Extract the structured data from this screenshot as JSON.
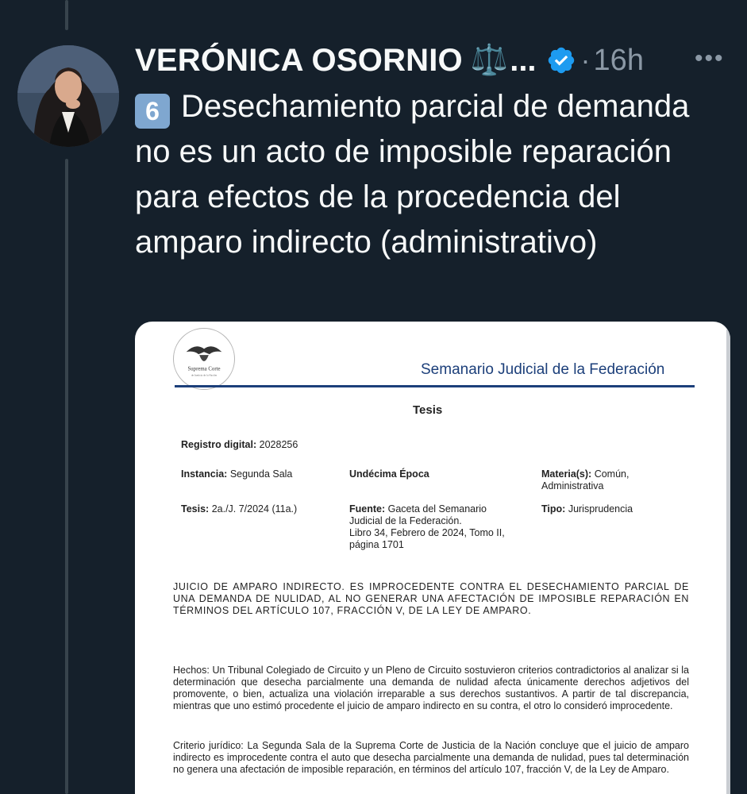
{
  "author": {
    "name": "VERÓNICA OSORNIO",
    "badge_emoji": "⚖️",
    "truncation": "...",
    "verified": true,
    "separator": "·",
    "time": "16h"
  },
  "more_label": "•••",
  "tweet": {
    "keycap": "6",
    "text": "Desechamiento parcial de demanda no es un acto de imposible reparación para efectos de la procedencia del amparo indirecto (administrativo)"
  },
  "document": {
    "logo_text": "Suprema Corte",
    "logo_subtext": "de Justicia de la Nación",
    "header_title": "Semanario Judicial de la Federación",
    "title": "Tesis",
    "registro_label": "Registro digital:",
    "registro_value": "2028256",
    "instancia_label": "Instancia:",
    "instancia_value": "Segunda Sala",
    "epoca": "Undécima Época",
    "materia_label": "Materia(s):",
    "materia_value_1": "Común,",
    "materia_value_2": "Administrativa",
    "tesis_label": "Tesis:",
    "tesis_value": "2a./J. 7/2024 (11a.)",
    "fuente_label": "Fuente:",
    "fuente_line_1": "Gaceta del Semanario",
    "fuente_line_2": "Judicial de la Federación.",
    "fuente_line_3": "Libro 34, Febrero de 2024, Tomo II,",
    "fuente_line_4": "página 1701",
    "tipo_label": "Tipo:",
    "tipo_value": "Jurisprudencia",
    "rubro": "JUICIO DE AMPARO INDIRECTO. ES IMPROCEDENTE CONTRA EL DESECHAMIENTO PARCIAL DE UNA DEMANDA DE NULIDAD, AL NO GENERAR UNA AFECTACIÓN DE IMPOSIBLE REPARACIÓN EN TÉRMINOS DEL ARTÍCULO 107, FRACCIÓN V, DE LA LEY DE AMPARO.",
    "hechos": "Hechos: Un Tribunal Colegiado de Circuito y un Pleno de Circuito sostuvieron criterios contradictorios al analizar si la determinación que desecha parcialmente una demanda de nulidad afecta únicamente derechos adjetivos del promovente, o bien, actualiza una violación irreparable a sus derechos sustantivos. A partir de tal discrepancia, mientras que uno estimó procedente el juicio de amparo indirecto en su contra, el otro lo consideró improcedente.",
    "criterio": "Criterio jurídico: La Segunda Sala de la Suprema Corte de Justicia de la Nación concluye que el juicio de amparo indirecto es improcedente contra el auto que desecha parcialmente una demanda de nulidad, pues tal determinación no genera una afectación de imposible reparación, en términos del artículo 107, fracción V, de la Ley de Amparo."
  }
}
